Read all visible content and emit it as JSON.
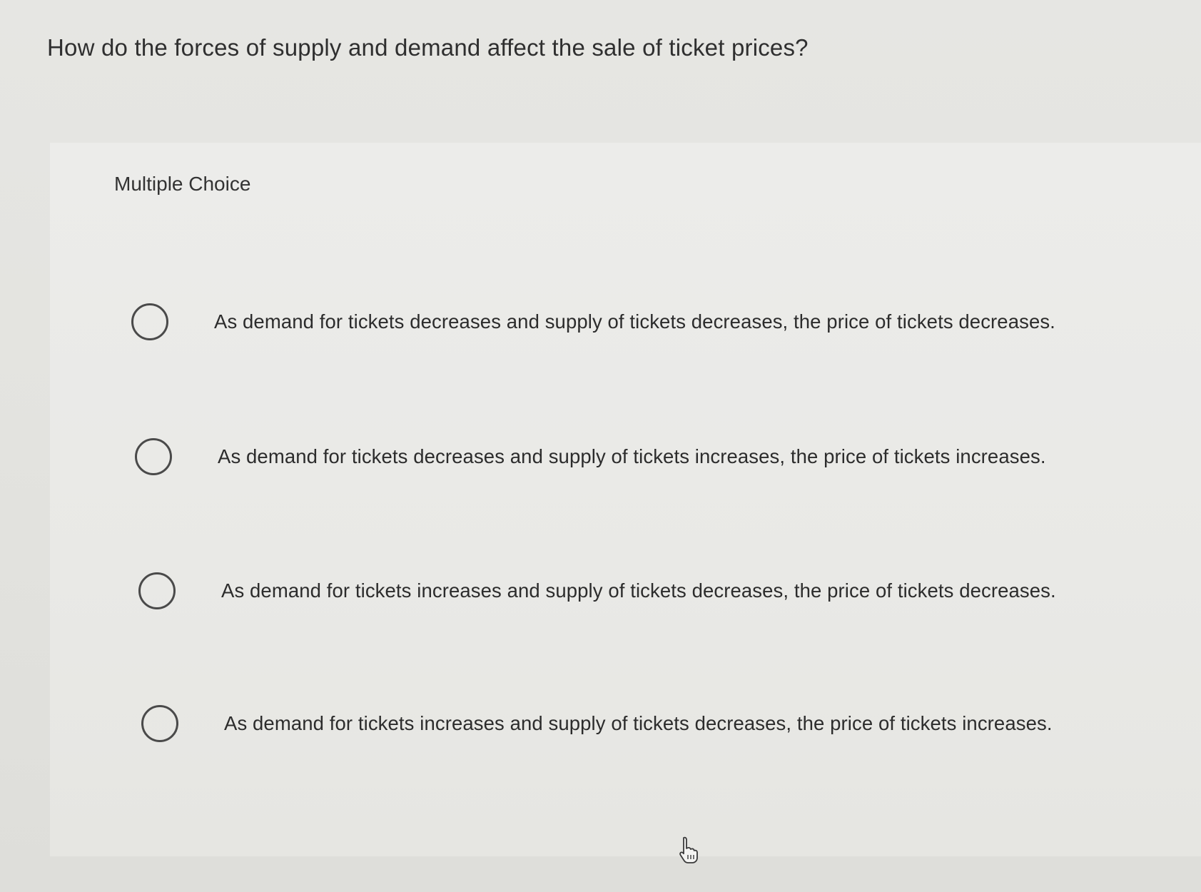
{
  "question": {
    "text": "How do the forces of supply and demand affect the sale of ticket prices?"
  },
  "panel": {
    "label": "Multiple Choice",
    "options": [
      {
        "text": "As demand for tickets decreases and supply of tickets decreases, the price of tickets decreases.",
        "selected": false
      },
      {
        "text": "As demand for tickets decreases and supply of tickets increases, the price of tickets increases.",
        "selected": false
      },
      {
        "text": "As demand for tickets increases and supply of tickets decreases, the price of tickets decreases.",
        "selected": false
      },
      {
        "text": "As demand for tickets increases and supply of tickets decreases, the price of tickets increases.",
        "selected": false
      }
    ]
  },
  "icons": {
    "radio": "radio-button-icon",
    "cursor": "hand-pointer-cursor-icon"
  }
}
